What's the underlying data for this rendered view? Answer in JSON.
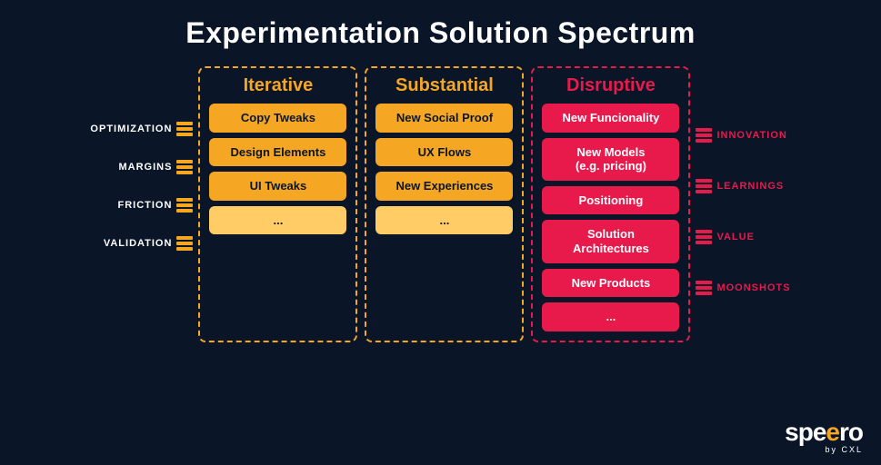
{
  "page": {
    "title": "Experimentation Solution Spectrum",
    "background_color": "#0a1628"
  },
  "left_labels": [
    {
      "text": "OPTIMIZATION",
      "id": "optimization"
    },
    {
      "text": "MARGINS",
      "id": "margins"
    },
    {
      "text": "FRICTION",
      "id": "friction"
    },
    {
      "text": "VALIDATION",
      "id": "validation"
    }
  ],
  "right_labels": [
    {
      "text": "INNOVATION",
      "id": "innovation"
    },
    {
      "text": "LEARNINGS",
      "id": "learnings"
    },
    {
      "text": "VALUE",
      "id": "value"
    },
    {
      "text": "MOONSHOTS",
      "id": "moonshots"
    }
  ],
  "columns": {
    "iterative": {
      "header": "Iterative",
      "cards": [
        {
          "label": "Copy Tweaks",
          "style": "orange"
        },
        {
          "label": "Design Elements",
          "style": "orange"
        },
        {
          "label": "UI Tweaks",
          "style": "orange"
        },
        {
          "label": "...",
          "style": "orange-light"
        }
      ]
    },
    "substantial": {
      "header": "Substantial",
      "cards": [
        {
          "label": "New Social Proof",
          "style": "orange"
        },
        {
          "label": "UX Flows",
          "style": "orange"
        },
        {
          "label": "New Experiences",
          "style": "orange"
        },
        {
          "label": "...",
          "style": "orange-light"
        }
      ]
    },
    "disruptive": {
      "header": "Disruptive",
      "cards": [
        {
          "label": "New Funcionality",
          "style": "red"
        },
        {
          "label": "New Models\n(e.g. pricing)",
          "style": "red"
        },
        {
          "label": "Positioning",
          "style": "red"
        },
        {
          "label": "Solution\nArchitectures",
          "style": "red"
        },
        {
          "label": "New Products",
          "style": "red"
        },
        {
          "label": "...",
          "style": "red"
        }
      ]
    }
  },
  "logo": {
    "text": "speero",
    "sub": "by CXL"
  }
}
